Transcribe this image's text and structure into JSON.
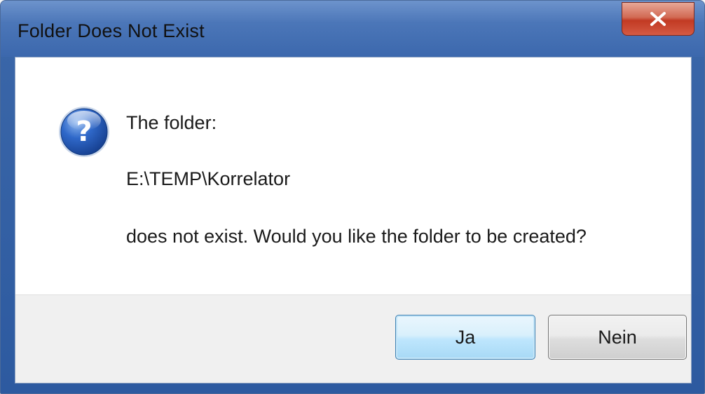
{
  "window": {
    "title": "Folder Does Not Exist",
    "close_icon": "close-icon"
  },
  "message": {
    "icon": "question-icon",
    "line1": "The folder:",
    "path": "E:\\TEMP\\Korrelator",
    "line3": "does not exist. Would you like the folder to be created?"
  },
  "buttons": {
    "yes_label": "Ja",
    "no_label": "Nein"
  },
  "colors": {
    "titlebar": "#4b76b8",
    "close": "#c23a23",
    "default_button_border": "#3c7fb1"
  }
}
